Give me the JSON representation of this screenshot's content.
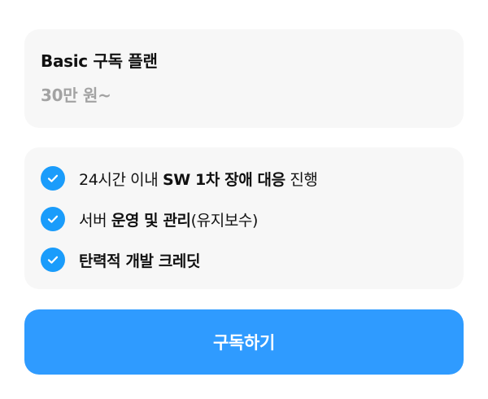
{
  "plan": {
    "title": "Basic 구독 플랜",
    "price": "30만 원~"
  },
  "features": [
    {
      "icon": "check-circle-icon",
      "parts": [
        {
          "text": "24시간 이내 ",
          "bold": false
        },
        {
          "text": "SW 1차 장애 대응",
          "bold": true
        },
        {
          "text": " 진행",
          "bold": false
        }
      ]
    },
    {
      "icon": "check-circle-icon",
      "parts": [
        {
          "text": "서버 ",
          "bold": false
        },
        {
          "text": "운영 및 관리",
          "bold": true
        },
        {
          "text": "(유지보수)",
          "bold": false
        }
      ]
    },
    {
      "icon": "check-circle-icon",
      "parts": [
        {
          "text": "탄력적 개발 크레딧",
          "bold": true
        }
      ]
    }
  ],
  "button": {
    "label": "구독하기"
  },
  "colors": {
    "accent": "#2f9bff",
    "check": "#1a9cfb",
    "card_bg": "#f7f7f7",
    "price_text": "#a3a3a3"
  }
}
